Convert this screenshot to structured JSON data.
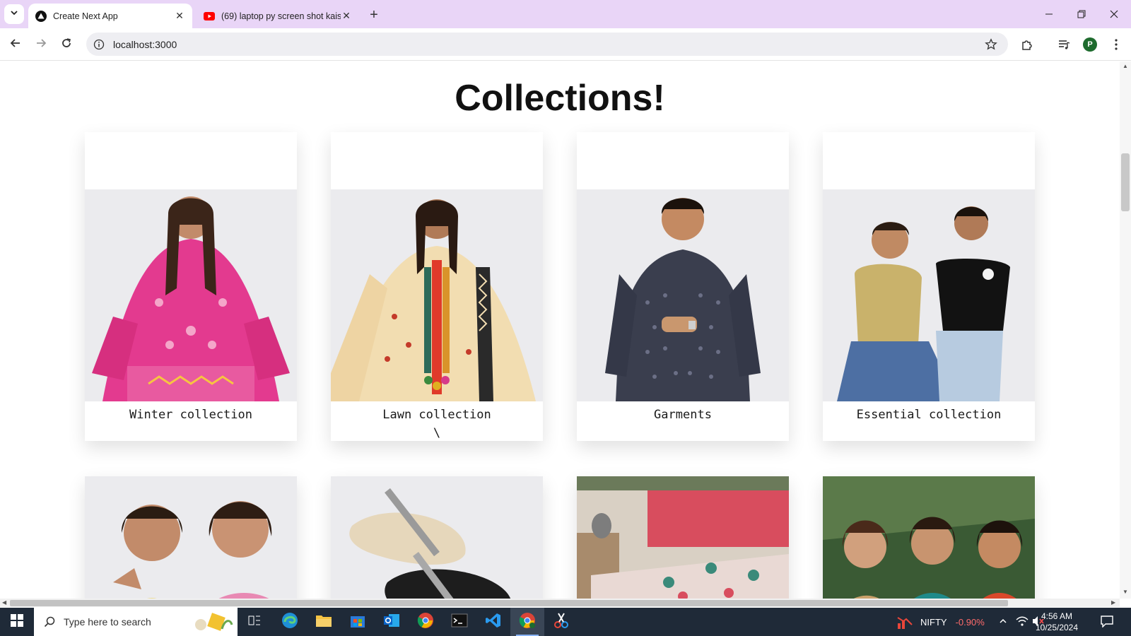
{
  "browser": {
    "tabs": [
      {
        "title": "Create Next App",
        "active": true
      },
      {
        "title": "(69) laptop py screen shot kaise",
        "active": false
      }
    ],
    "url": "localhost:3000",
    "profile_initial": "P"
  },
  "page": {
    "heading": "Collections!",
    "cards": [
      {
        "label": "Winter collection",
        "extra": ""
      },
      {
        "label": "Lawn collection",
        "extra": "\\"
      },
      {
        "label": "Garments",
        "extra": ""
      },
      {
        "label": "Essential collection",
        "extra": ""
      }
    ]
  },
  "taskbar": {
    "search_placeholder": "Type here to search",
    "stock_name": "NIFTY",
    "stock_change": "-0.90%",
    "time": "4:56 AM",
    "date": "10/25/2024"
  },
  "colors": {
    "tab_strip": "#e9d5f7",
    "taskbar": "#1f2a38",
    "stock_negative": "#ff6b6b",
    "profile": "#1e6b2e"
  }
}
